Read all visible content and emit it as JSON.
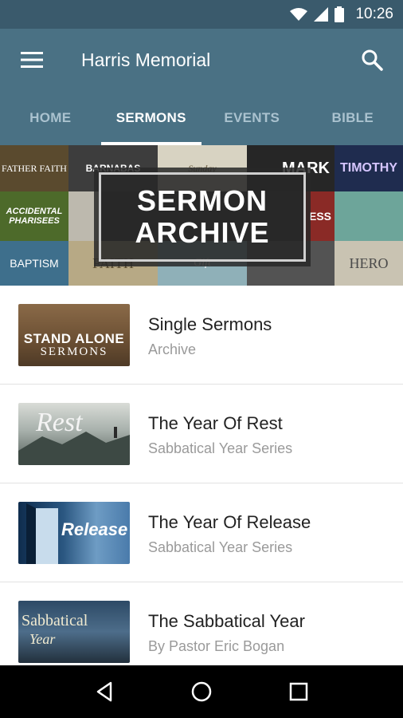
{
  "status_bar": {
    "time": "10:26"
  },
  "app_bar": {
    "title": "Harris Memorial"
  },
  "tabs": [
    {
      "label": "HOME"
    },
    {
      "label": "SERMONS"
    },
    {
      "label": "EVENTS"
    },
    {
      "label": "BIBLE"
    }
  ],
  "active_tab": "SERMONS",
  "banner": {
    "line1": "SERMON",
    "line2": "ARCHIVE",
    "tiles": [
      "FATHER FAITH",
      "BARNABAS",
      "Sunday",
      "MARK",
      "TIMOTHY",
      "ACCIDENTAL PHARISEES",
      "ESS",
      "HERO",
      "BAPTISM",
      "FAITH",
      "Gift"
    ]
  },
  "sermons": [
    {
      "title": "Single Sermons",
      "subtitle": "Archive",
      "thumb_text": [
        "STAND ALONE",
        "SERMONS"
      ]
    },
    {
      "title": "The Year Of Rest",
      "subtitle": "Sabbatical Year Series",
      "thumb_text": [
        "Rest"
      ]
    },
    {
      "title": "The Year Of Release",
      "subtitle": "Sabbatical Year Series",
      "thumb_text": [
        "Release"
      ]
    },
    {
      "title": "The Sabbatical Year",
      "subtitle": "By Pastor Eric Bogan",
      "thumb_text": [
        "Sabbatical",
        "Year"
      ]
    }
  ],
  "colors": {
    "status_bar": "#3a5a6c",
    "app_bar": "#4a7184",
    "tab_inactive": "#aac2cf",
    "title_text": "#222222",
    "subtitle_text": "#9a9a9a",
    "nav_bar": "#000000"
  },
  "icons": {
    "menu": "hamburger-menu-icon",
    "search": "search-icon",
    "wifi": "wifi-icon",
    "signal": "signal-icon",
    "battery": "battery-icon",
    "back": "back-icon",
    "home": "home-icon",
    "recents": "recents-icon"
  }
}
